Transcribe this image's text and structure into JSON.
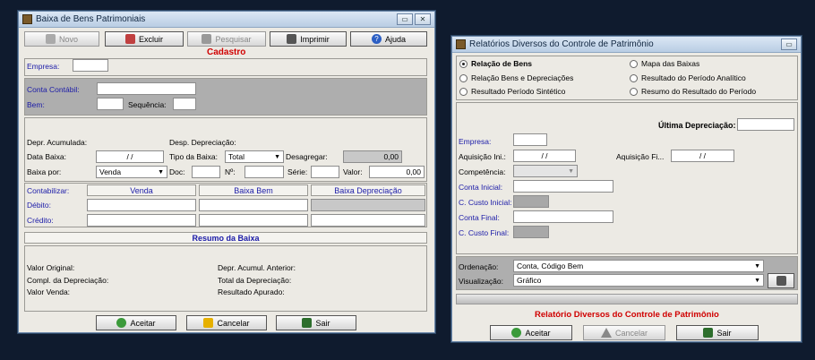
{
  "win1": {
    "title": "Baixa de Bens Patrimoniais",
    "toolbar": {
      "novo": "Novo",
      "excluir": "Excluir",
      "pesquisar": "Pesquisar",
      "imprimir": "Imprimir",
      "ajuda": "Ajuda"
    },
    "section_title": "Cadastro",
    "empresa_label": "Empresa:",
    "conta_contabil_label": "Conta Contábil:",
    "bem_label": "Bem:",
    "sequencia_label": "Sequência:",
    "depr_acumulada_label": "Depr. Acumulada:",
    "desp_depreciacao_label": "Desp. Depreciação:",
    "data_baixa_label": "Data Baixa:",
    "data_baixa_value": "/ /",
    "tipo_baixa_label": "Tipo da Baixa:",
    "tipo_baixa_value": "Total",
    "desagregar_label": "Desagregar:",
    "desagregar_value": "0,00",
    "baixa_por_label": "Baixa por:",
    "baixa_por_value": "Venda",
    "doc_label": "Doc:",
    "n_label": "Nº:",
    "serie_label": "Série:",
    "valor_label": "Valor:",
    "valor_value": "0,00",
    "contabilizar_label": "Contabilizar:",
    "col_venda": "Venda",
    "col_baixa_bem": "Baixa Bem",
    "col_baixa_depr": "Baixa Depreciação",
    "debito_label": "Débito:",
    "credito_label": "Crédito:",
    "resumo_title": "Resumo da Baixa",
    "valor_original_label": "Valor Original:",
    "compl_depreciacao_label": "Compl. da Depreciação:",
    "valor_venda_label": "Valor Venda:",
    "depr_acumul_anterior_label": "Depr. Acumul. Anterior:",
    "total_depreciacao_label": "Total da Depreciação:",
    "resultado_apurado_label": "Resultado Apurado:",
    "aceitar": "Aceitar",
    "cancelar": "Cancelar",
    "sair": "Sair"
  },
  "win2": {
    "title": "Relatórios Diversos do Controle de Patrimônio",
    "radios": [
      {
        "label": "Relação de Bens",
        "selected": true
      },
      {
        "label": "Mapa das Baixas",
        "selected": false
      },
      {
        "label": "Relação Bens e Depreciações",
        "selected": false
      },
      {
        "label": "Resultado do Período Analítico",
        "selected": false
      },
      {
        "label": "Resultado Período Sintético",
        "selected": false
      },
      {
        "label": "Resumo do Resultado do Período",
        "selected": false
      }
    ],
    "ultima_depreciacao_label": "Última Depreciação:",
    "empresa_label": "Empresa:",
    "aquisicao_ini_label": "Aquisição Ini.:",
    "aquisicao_ini_value": "/ /",
    "aquisicao_fi_label": "Aquisição Fi...",
    "aquisicao_fi_value": "/ /",
    "competencia_label": "Competência:",
    "conta_inicial_label": "Conta Inicial:",
    "c_custo_inicial_label": "C. Custo Inicial:",
    "conta_final_label": "Conta Final:",
    "c_custo_final_label": "C. Custo Final:",
    "ordenacao_label": "Ordenação:",
    "ordenacao_value": "Conta, Código Bem",
    "visualizacao_label": "Visualização:",
    "visualizacao_value": "Gráfico",
    "footer_title": "Relatório Diversos do Controle de Patrimônio",
    "aceitar": "Aceitar",
    "cancelar": "Cancelar",
    "sair": "Sair"
  }
}
